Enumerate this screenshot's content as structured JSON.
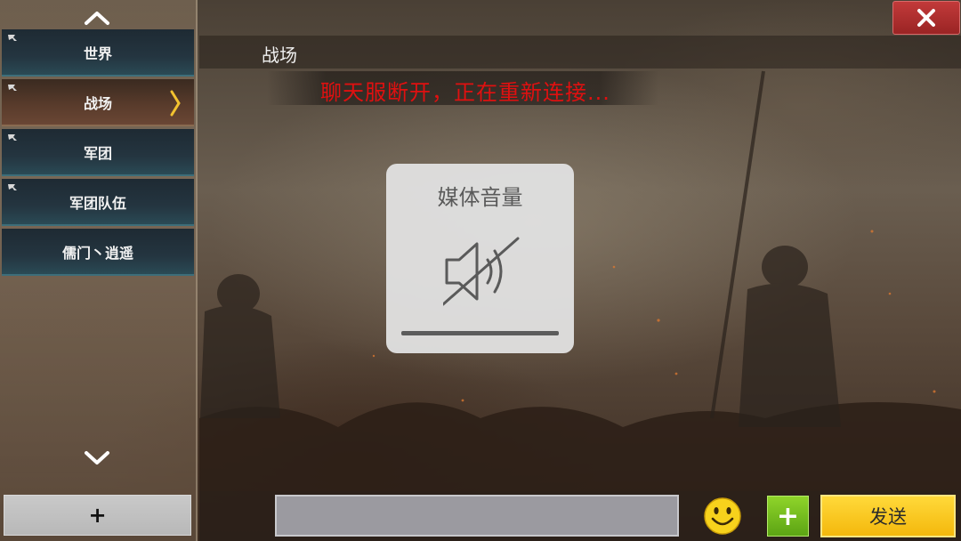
{
  "colors": {
    "notice_text": "#e01010",
    "send_button": "#f4b80c",
    "plus_button": "#6cb41a",
    "close_button": "#b02e2e",
    "active_channel": "#5a3c2c"
  },
  "sidebar": {
    "scroll_up_icon": "chevron-up-icon",
    "scroll_down_icon": "chevron-down-icon",
    "channels": [
      {
        "label": "世界",
        "pinned": true,
        "active": false
      },
      {
        "label": "战场",
        "pinned": true,
        "active": true
      },
      {
        "label": "军团",
        "pinned": true,
        "active": false
      },
      {
        "label": "军团队伍",
        "pinned": true,
        "active": false
      },
      {
        "label": "儒门丶逍遥",
        "pinned": false,
        "active": false
      }
    ],
    "add_label": "+"
  },
  "chat": {
    "title": "战场",
    "notice": "聊天服断开，正在重新连接...",
    "close_icon": "close-icon"
  },
  "volume_overlay": {
    "title": "媒体音量",
    "icon": "speaker-muted-icon",
    "level": 0
  },
  "input_bar": {
    "input_value": "",
    "emoji_icon": "smiley-icon",
    "plus_label": "+",
    "send_label": "发送"
  }
}
